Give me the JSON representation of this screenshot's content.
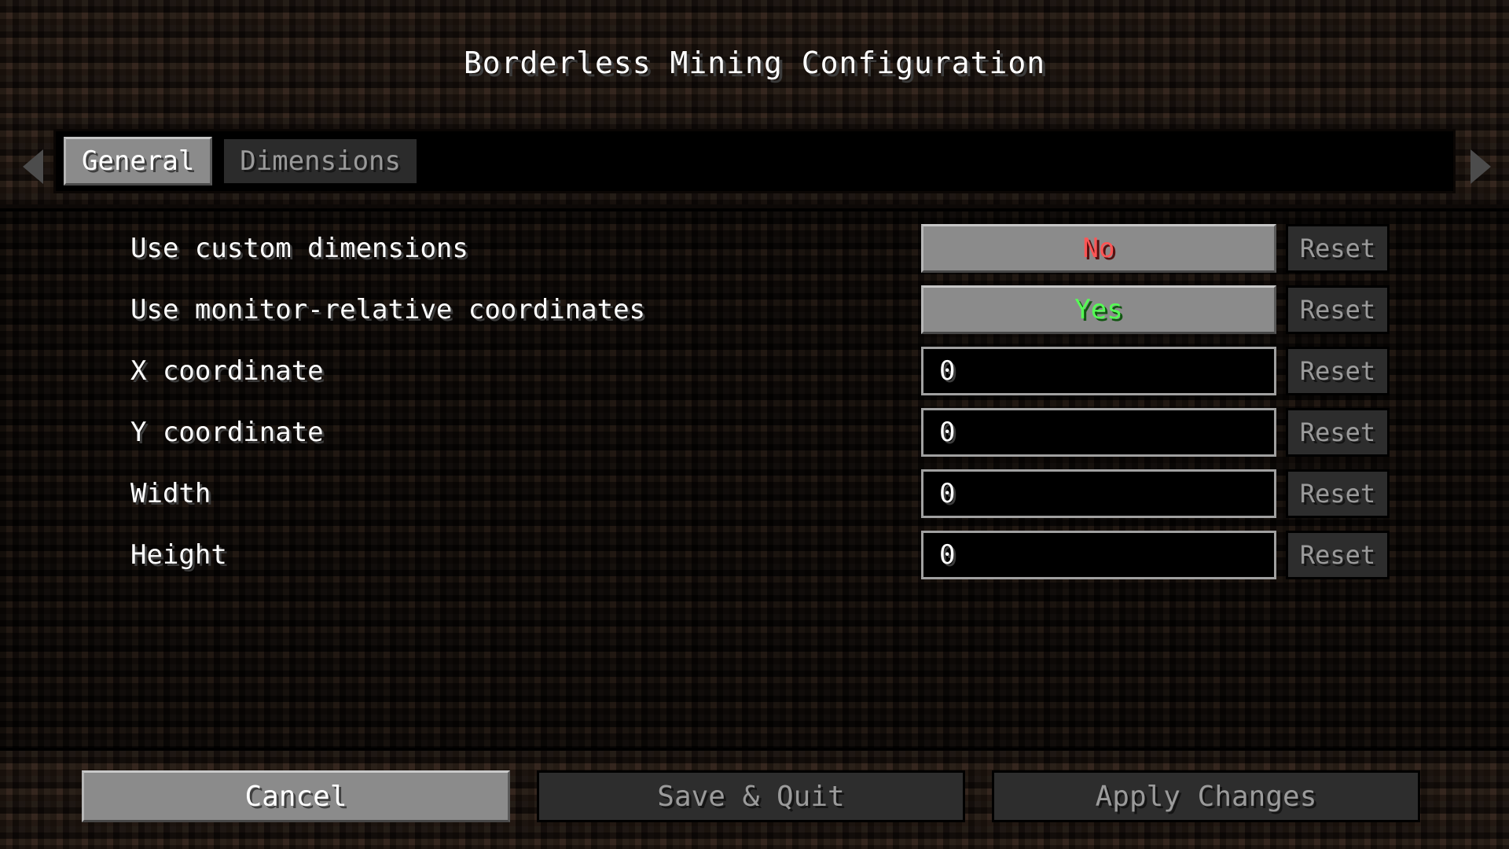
{
  "window": {
    "title": "Borderless Mining Configuration"
  },
  "tabs": {
    "nav_left_icon": "triangle-left-icon",
    "nav_right_icon": "triangle-right-icon",
    "items": [
      {
        "label": "General",
        "active": true
      },
      {
        "label": "Dimensions",
        "active": false
      }
    ]
  },
  "settings": {
    "reset_label": "Reset",
    "rows": [
      {
        "label": "Use custom dimensions",
        "type": "toggle",
        "value": "No",
        "value_color": "#ff5555",
        "reset_label": "Reset"
      },
      {
        "label": "Use monitor-relative coordinates",
        "type": "toggle",
        "value": "Yes",
        "value_color": "#55ff55",
        "reset_label": "Reset"
      },
      {
        "label": "X coordinate",
        "type": "text",
        "value": "0",
        "placeholder": "",
        "reset_label": "Reset"
      },
      {
        "label": "Y coordinate",
        "type": "text",
        "value": "0",
        "placeholder": "",
        "reset_label": "Reset"
      },
      {
        "label": "Width",
        "type": "text",
        "value": "0",
        "placeholder": "",
        "reset_label": "Reset"
      },
      {
        "label": "Height",
        "type": "text",
        "value": "0",
        "placeholder": "",
        "reset_label": "Reset"
      }
    ]
  },
  "footer": {
    "cancel_label": "Cancel",
    "save_label": "Save & Quit",
    "apply_label": "Apply Changes"
  },
  "colors": {
    "value_true": "#55ff55",
    "value_false": "#ff5555",
    "button_enabled": "#8b8b8b",
    "button_disabled": "#2d2d2d",
    "text_primary": "#ffffff",
    "text_disabled": "#9b9b9b",
    "field_background": "#000000",
    "field_border": "#a0a0a0"
  }
}
